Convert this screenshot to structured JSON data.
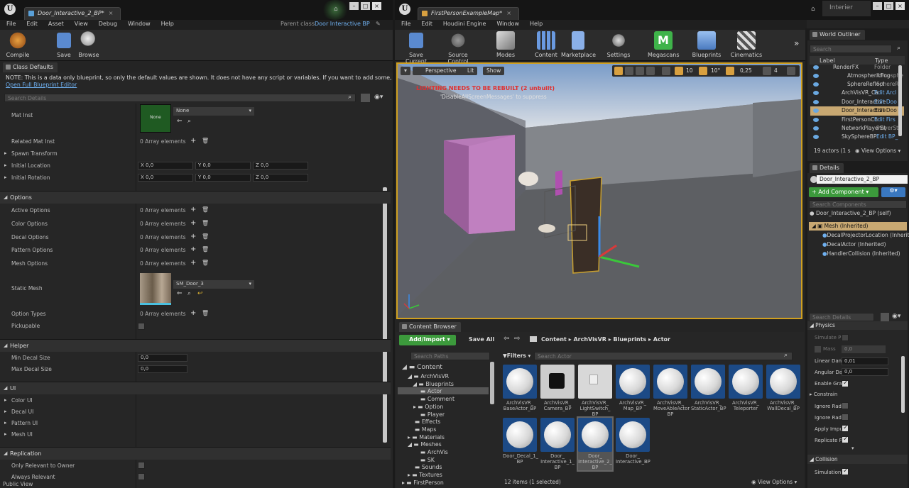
{
  "left_window": {
    "tab_title": "Door_Interactive_2_BP*",
    "parent_class_label": "Parent class:",
    "parent_class_value": "Door Interactive BP",
    "menu": [
      "File",
      "Edit",
      "Asset",
      "View",
      "Debug",
      "Window",
      "Help"
    ],
    "toolbar": {
      "compile": "Compile",
      "save": "Save",
      "browse": "Browse"
    },
    "class_defaults_tab": "Class Defaults",
    "note": "NOTE: This is a data only blueprint, so only the default values are shown.  It does not have any script or variables.  If you want to add some,",
    "note_link": "Open Full Blueprint Editor",
    "search_placeholder": "Search Details",
    "props": {
      "mat_inst": "Mat Inst",
      "mat_inst_value": "None",
      "mat_thumb": "None",
      "related_mat_inst": "Related Mat Inst",
      "array0": "0 Array elements",
      "spawn_transform": "Spawn Transform",
      "initial_location": "Initial Location",
      "initial_rotation": "Initial Rotation",
      "x": "X",
      "y": "Y",
      "z": "Z",
      "zero": "0,0",
      "options": "Options",
      "active_options": "Active Options",
      "color_options": "Color Options",
      "decal_options": "Decal Options",
      "pattern_options": "Pattern Options",
      "mesh_options": "Mesh Options",
      "static_mesh": "Static Mesh",
      "static_mesh_value": "SM_Door_3",
      "option_types": "Option Types",
      "pickupable": "Pickupable",
      "helper": "Helper",
      "min_decal": "Min Decal Size",
      "max_decal": "Max Decal Size",
      "decal_val": "0,0",
      "ui": "UI",
      "color_ui": "Color UI",
      "decal_ui": "Decal UI",
      "pattern_ui": "Pattern UI",
      "mesh_ui": "Mesh UI",
      "replication": "Replication",
      "only_relevant": "Only Relevant to Owner",
      "always_relevant": "Always Relevant",
      "public_view": "Public View"
    }
  },
  "right_window": {
    "tab_title": "FirstPersonExampleMap*",
    "project": "Interier",
    "menu": [
      "File",
      "Edit",
      "Houdini Engine",
      "Window",
      "Help"
    ],
    "toolbar": [
      "Save Current",
      "Source Control",
      "Modes",
      "Content",
      "Marketplace",
      "Settings",
      "Megascans",
      "Blueprints",
      "Cinematics"
    ],
    "viewport": {
      "perspective": "Perspective",
      "lit": "Lit",
      "show": "Show",
      "warning": "LIGHTING NEEDS TO BE REBUILT (2 unbuilt)",
      "suppress": "'DisableAllScreenMessages' to suppress",
      "snap_grid": "10",
      "snap_rot": "10°",
      "snap_scale": "0,25",
      "cam_speed": "4"
    },
    "content_browser": {
      "tab": "Content Browser",
      "add_import": "Add/Import",
      "save_all": "Save All",
      "path": [
        "Content",
        "ArchVisVR",
        "Blueprints",
        "Actor"
      ],
      "search_paths": "Search Paths",
      "filters": "Filters",
      "search_actor": "Search Actor",
      "tree": [
        "Content",
        "ArchVisVR",
        "Blueprints",
        "Actor",
        "Comment",
        "Option",
        "Player",
        "Effects",
        "Maps",
        "Materials",
        "Meshes",
        "ArchVis",
        "SK",
        "Sounds",
        "Textures",
        "FirstPerson"
      ],
      "assets": [
        {
          "name": "ArchVisVR_\nBaseActor_BP"
        },
        {
          "name": "ArchVisVR_\nCamera_BP"
        },
        {
          "name": "ArchVisVR_\nLightSwitch_\nBP"
        },
        {
          "name": "ArchVisVR_\nMap_BP"
        },
        {
          "name": "ArchVisVR_\nMoveAbleActor\nBP"
        },
        {
          "name": "ArchVisVR_\nStaticActor_BP"
        },
        {
          "name": "ArchVisVR_\nTeleporter"
        },
        {
          "name": "ArchVisVR_\nWallDecal_BP"
        },
        {
          "name": "Door_Decal_1_\nBP"
        },
        {
          "name": "Door_\nInteractive_1_\nBP"
        },
        {
          "name": "Door_\nInteractive_2_\nBP"
        },
        {
          "name": "Door_\nInteractive_BP"
        }
      ],
      "status": "12 items (1 selected)",
      "view_options": "View Options"
    },
    "outliner": {
      "tab": "World Outliner",
      "search": "Search",
      "label_col": "Label",
      "type_col": "Type",
      "rows": [
        {
          "label": "RenderFX",
          "type": "Folder"
        },
        {
          "label": "AtmosphericFog",
          "type": "Atmosphe"
        },
        {
          "label": "SphereReflect",
          "type": "SphereRe"
        },
        {
          "label": "ArchVisVR_Ca",
          "type": "Edit Arcl"
        },
        {
          "label": "Door_Interactive",
          "type": "Edit Doo"
        },
        {
          "label": "Door_Interactive",
          "type": "Edit Doo"
        },
        {
          "label": "FirstPersonCh",
          "type": "Edit Firs"
        },
        {
          "label": "NetworkPlayerSt",
          "type": "PlayerSt"
        },
        {
          "label": "SkySphereBP",
          "type": "Edit BP_"
        }
      ],
      "count": "19 actors (1 s",
      "view_options": "View Options"
    },
    "details": {
      "tab": "Details",
      "name": "Door_Interactive_2_BP",
      "add_component": "+ Add Component",
      "search_components": "Search Components",
      "self": "Door_Interactive_2_BP (self)",
      "components": [
        "Mesh (Inherited)",
        "DecalProjectorLocation (Inherited)",
        "DecalActor (Inherited)",
        "HandlerCollision (Inherited)"
      ],
      "search_details": "Search Details",
      "physics": "Physics",
      "phys_rows": [
        "Simulate P",
        "Mass",
        "Linear Dan",
        "Angular Da",
        "Enable Gra",
        "Constrain",
        "Ignore Rad",
        "Ignore Rad",
        "Apply Impu",
        "Replicate P"
      ],
      "mass_val": "0,0",
      "linear_val": "0,01",
      "angular_val": "0,0",
      "collision": "Collision",
      "simulation": "Simulation"
    }
  }
}
